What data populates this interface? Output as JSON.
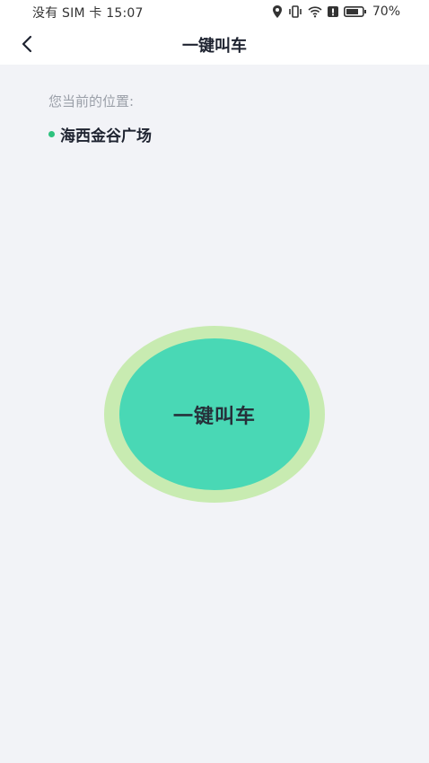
{
  "status_bar": {
    "left_text": "没有 SIM 卡 15:07",
    "battery_text": "70%",
    "icons": [
      "location-icon",
      "vibrate-icon",
      "wifi-icon",
      "alert-icon",
      "battery-icon"
    ]
  },
  "header": {
    "back_icon": "chevron-left-icon",
    "title": "一键叫车"
  },
  "location": {
    "label": "您当前的位置:",
    "name": "海西金谷广场",
    "dot_color": "#2ec27e"
  },
  "call_button": {
    "label": "一键叫车",
    "outer_color": "#c8ebb1",
    "inner_color": "#49d8b5"
  }
}
